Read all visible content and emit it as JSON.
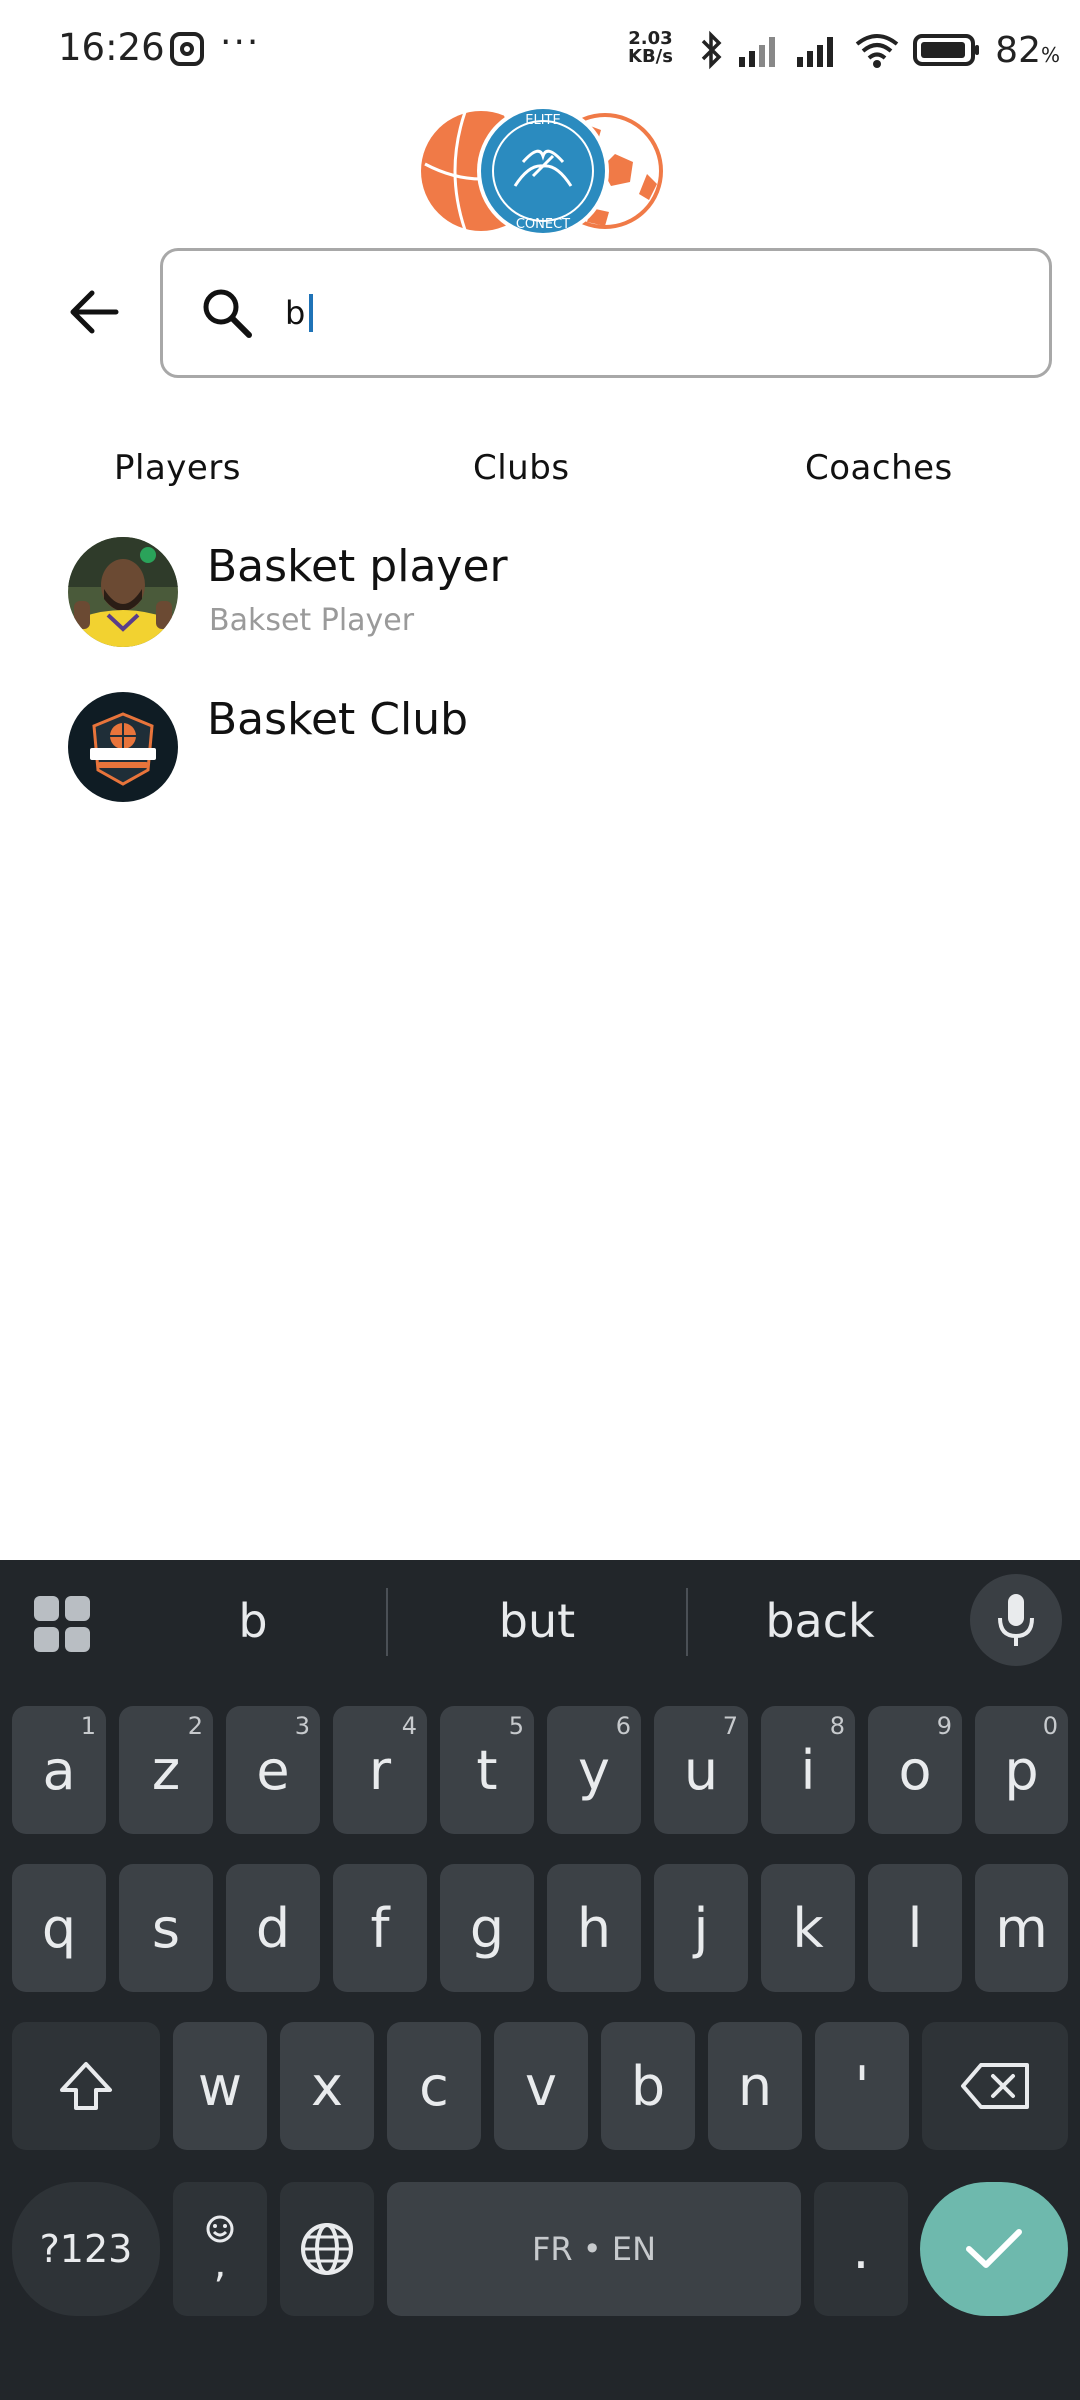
{
  "status_bar": {
    "time": "16:26",
    "dots": "···",
    "speed_value": "2.03",
    "speed_unit": "KB/s",
    "battery_pct": "82",
    "battery_unit": "%"
  },
  "logo": {
    "top_text": "ELITE",
    "bottom_text": "CONECT",
    "colors": {
      "ball": "#f07a47",
      "badge": "#2b8bbf"
    }
  },
  "search": {
    "value": "b"
  },
  "tabs": [
    {
      "label": "Players"
    },
    {
      "label": "Clubs"
    },
    {
      "label": "Coaches"
    }
  ],
  "results": [
    {
      "title": "Basket player",
      "subtitle": "Bakset Player",
      "avatar": "player-photo"
    },
    {
      "title": "Basket Club",
      "subtitle": "",
      "avatar": "dream-team-logo"
    }
  ],
  "keyboard": {
    "suggestions": [
      "b",
      "but",
      "back"
    ],
    "row1": [
      {
        "k": "a",
        "h": "1"
      },
      {
        "k": "z",
        "h": "2"
      },
      {
        "k": "e",
        "h": "3"
      },
      {
        "k": "r",
        "h": "4"
      },
      {
        "k": "t",
        "h": "5"
      },
      {
        "k": "y",
        "h": "6"
      },
      {
        "k": "u",
        "h": "7"
      },
      {
        "k": "i",
        "h": "8"
      },
      {
        "k": "o",
        "h": "9"
      },
      {
        "k": "p",
        "h": "0"
      }
    ],
    "row2": [
      "q",
      "s",
      "d",
      "f",
      "g",
      "h",
      "j",
      "k",
      "l",
      "m"
    ],
    "row3": [
      "w",
      "x",
      "c",
      "v",
      "b",
      "n",
      "'"
    ],
    "sym_label": "?123",
    "emoji_comma": ",",
    "space_label": "FR • EN",
    "period": ".",
    "accent": "#6eb9ad"
  }
}
